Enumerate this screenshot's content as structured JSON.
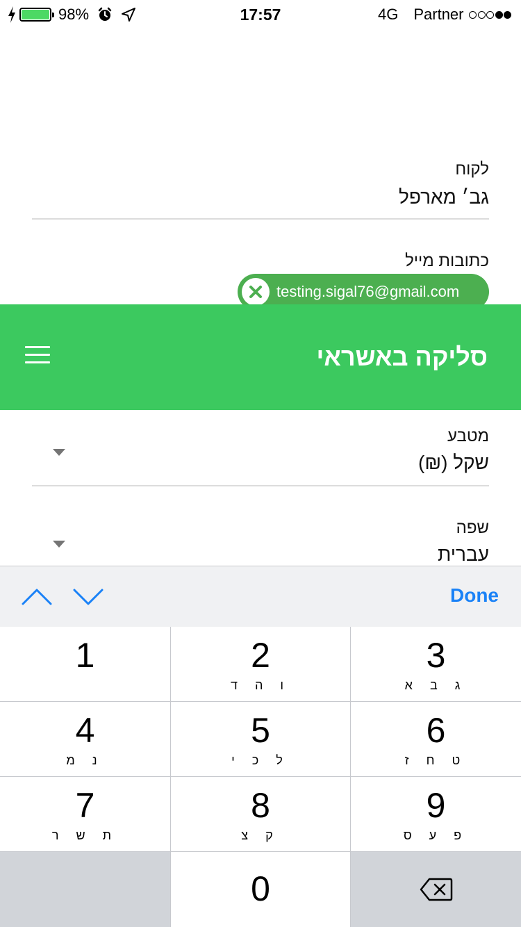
{
  "status_bar": {
    "battery_percent": "98%",
    "time": "17:57",
    "network": "4G",
    "carrier": "Partner",
    "signal_bars_filled": 2,
    "signal_bars_total": 5
  },
  "customer_field": {
    "label": "לקוח",
    "value": "גב׳ מארפל"
  },
  "email_field": {
    "label": "כתובות מייל",
    "chip_value": "testing.sigal76@gmail.com"
  },
  "header": {
    "title": "סליקה באשראי",
    "background_color": "#3cc95f"
  },
  "currency_field": {
    "label": "מטבע",
    "value": "שקל (₪)"
  },
  "language_field": {
    "label": "שפה",
    "value": "עברית"
  },
  "keyboard_toolbar": {
    "done_label": "Done",
    "accent_color": "#1a82f7"
  },
  "keypad": {
    "keys": [
      {
        "num": "1",
        "letters": ""
      },
      {
        "num": "2",
        "letters": "ו ה ד"
      },
      {
        "num": "3",
        "letters": "ג ב א"
      },
      {
        "num": "4",
        "letters": "נ מ"
      },
      {
        "num": "5",
        "letters": "ל כ י"
      },
      {
        "num": "6",
        "letters": "ט ח ז"
      },
      {
        "num": "7",
        "letters": "ת ש ר"
      },
      {
        "num": "8",
        "letters": "ק צ"
      },
      {
        "num": "9",
        "letters": "פ ע ס"
      },
      {
        "num": "0",
        "letters": ""
      }
    ]
  }
}
